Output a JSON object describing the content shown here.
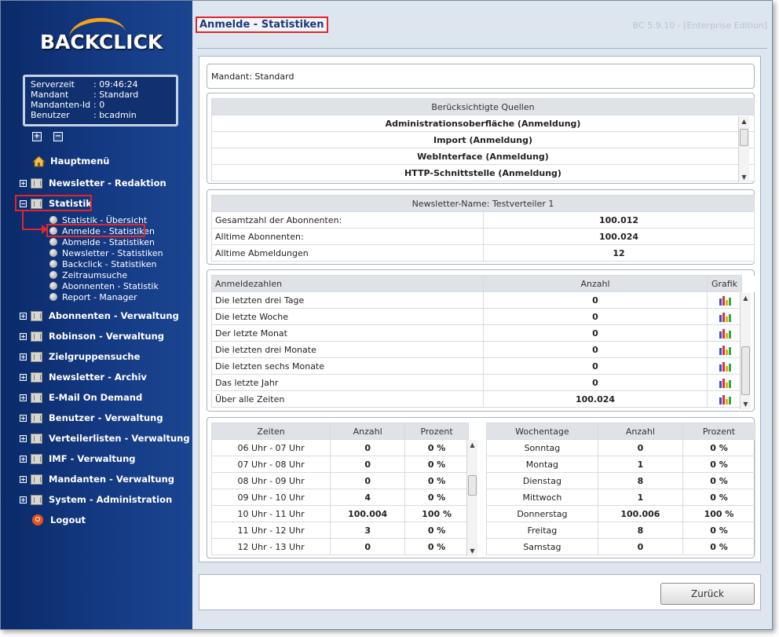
{
  "logo": {
    "text": "BACKCLICK"
  },
  "info": {
    "rows": [
      {
        "k": "Serverzeit",
        "v": ": 09:46:24"
      },
      {
        "k": "Mandant",
        "v": ": Standard"
      },
      {
        "k": "Mandanten-Id",
        "v": ": 0"
      },
      {
        "k": "Benutzer",
        "v": ": bcadmin"
      }
    ]
  },
  "tree_toggles": {
    "expand": "+",
    "collapse": "−"
  },
  "nav": {
    "home": "Hauptmenü",
    "redaktion": "Newsletter - Redaktion",
    "statistik": "Statistik",
    "sub": [
      "Statistik - Übersicht",
      "Anmelde - Statistiken",
      "Abmelde - Statistiken",
      "Newsletter - Statistiken",
      "Backclick - Statistiken",
      "Zeitraumsuche",
      "Abonnenten - Statistik",
      "Report - Manager"
    ],
    "items": [
      "Abonnenten - Verwaltung",
      "Robinson - Verwaltung",
      "Zielgruppensuche",
      "Newsletter - Archiv",
      "E-Mail On Demand",
      "Benutzer - Verwaltung",
      "Verteilerlisten - Verwaltung",
      "IMF - Verwaltung",
      "Mandanten - Verwaltung",
      "System - Administration"
    ],
    "logout": "Logout"
  },
  "page": {
    "title": "Anmelde - Statistiken",
    "version": "BC 5.9.10 - [Enterprise Edition]",
    "mandant": "Mandant: Standard"
  },
  "quellen": {
    "header": "Berücksichtigte Quellen",
    "rows": [
      "Administrationsoberfläche (Anmeldung)",
      "Import (Anmeldung)",
      "WebInterface (Anmeldung)",
      "HTTP-Schnittstelle (Anmeldung)"
    ]
  },
  "summary": {
    "header": "Newsletter-Name:  Testverteiler 1",
    "rows": [
      {
        "label": "Gesamtzahl der Abonnenten:",
        "value": "100.012"
      },
      {
        "label": "Alltime Abonnenten:",
        "value": "100.024"
      },
      {
        "label": "Alltime Abmeldungen",
        "value": "12"
      }
    ]
  },
  "anmeldezahlen": {
    "headers": [
      "Anmeldezahlen",
      "Anzahl",
      "Grafik"
    ],
    "rows": [
      {
        "label": "Die letzten drei Tage",
        "value": "0"
      },
      {
        "label": "Die letzte Woche",
        "value": "0"
      },
      {
        "label": "Der letzte Monat",
        "value": "0"
      },
      {
        "label": "Die letzten drei Monate",
        "value": "0"
      },
      {
        "label": "Die letzten sechs Monate",
        "value": "0"
      },
      {
        "label": "Das letzte Jahr",
        "value": "0"
      },
      {
        "label": "Über alle Zeiten",
        "value": "100.024"
      }
    ]
  },
  "zeiten": {
    "headers": [
      "Zeiten",
      "Anzahl",
      "Prozent"
    ],
    "rows": [
      [
        "06 Uhr - 07 Uhr",
        "0",
        "0 %"
      ],
      [
        "07 Uhr - 08 Uhr",
        "0",
        "0 %"
      ],
      [
        "08 Uhr - 09 Uhr",
        "0",
        "0 %"
      ],
      [
        "09 Uhr - 10 Uhr",
        "4",
        "0 %"
      ],
      [
        "10 Uhr - 11 Uhr",
        "100.004",
        "100 %"
      ],
      [
        "11 Uhr - 12 Uhr",
        "3",
        "0 %"
      ],
      [
        "12 Uhr - 13 Uhr",
        "0",
        "0 %"
      ]
    ]
  },
  "wochentage": {
    "headers": [
      "Wochentage",
      "Anzahl",
      "Prozent"
    ],
    "rows": [
      [
        "Sonntag",
        "0",
        "0 %"
      ],
      [
        "Montag",
        "1",
        "0 %"
      ],
      [
        "Dienstag",
        "8",
        "0 %"
      ],
      [
        "Mittwoch",
        "1",
        "0 %"
      ],
      [
        "Donnerstag",
        "100.006",
        "100 %"
      ],
      [
        "Freitag",
        "8",
        "0 %"
      ],
      [
        "Samstag",
        "0",
        "0 %"
      ]
    ]
  },
  "buttons": {
    "back": "Zurück"
  },
  "colors": {
    "sidebar": "#0a2a68",
    "highlight": "#e0262a",
    "accent": "#f3a21a"
  }
}
